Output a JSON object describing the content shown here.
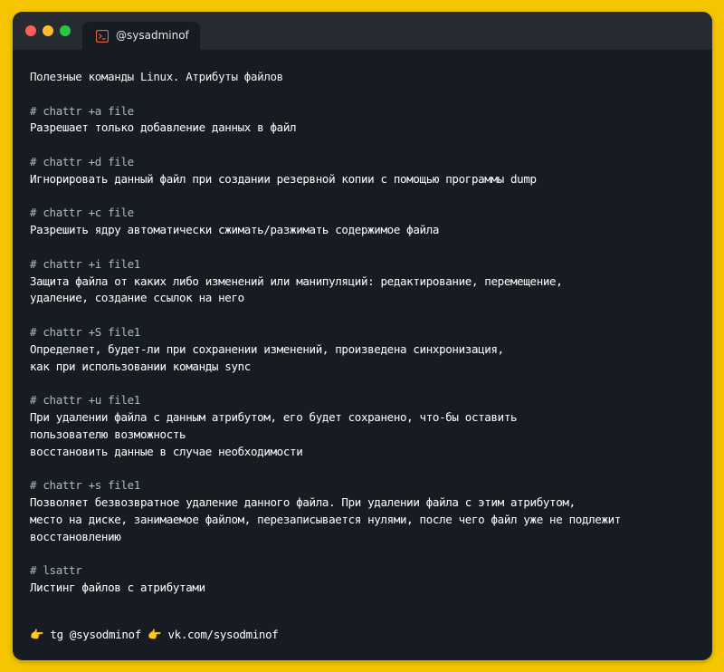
{
  "window": {
    "colors": {
      "background": "#171b22",
      "titlebar": "#262a31",
      "frame": "#f5c600"
    },
    "tab_label": "@sysadminof",
    "tab_icon": "terminal-icon"
  },
  "content": {
    "title": "Полезные команды Linux. Атрибуты файлов",
    "blocks": [
      {
        "cmd": "# chattr +a file",
        "desc": [
          "Разрешает только добавление данных в файл"
        ]
      },
      {
        "cmd": "# chattr +d file",
        "desc": [
          "Игнорировать данный файл при создании резервной копии с помощью программы dump"
        ]
      },
      {
        "cmd": "# chattr +c file",
        "desc": [
          "Разрешить ядру автоматически сжимать/разжимать содержимое файла"
        ]
      },
      {
        "cmd": "# chattr +i file1",
        "desc": [
          "Защита файла от каких либо изменений или манипуляций: редактирование, перемещение,",
          "удаление, создание ссылок на него"
        ]
      },
      {
        "cmd": "# chattr +S file1",
        "desc": [
          "Определяет, будет-ли при сохранении изменений, произведена синхронизация,",
          "как при использовании команды sync"
        ]
      },
      {
        "cmd": "# chattr +u file1",
        "desc": [
          "При удалении файла с данным атрибутом, его будет сохранено, что-бы оставить",
          "пользователю возможность",
          "восстановить данные в случае необходимости"
        ]
      },
      {
        "cmd": "# chattr +s file1",
        "desc": [
          "Позволяет безвозвратное удаление данного файла. При удалении файла с этим атрибутом,",
          "место на диске, занимаемое файлом, перезаписывается нулями, после чего файл уже не подлежит",
          "восстановлению"
        ]
      },
      {
        "cmd": "# lsattr",
        "desc": [
          "Листинг файлов с атрибутами"
        ]
      }
    ]
  },
  "footer": {
    "pointer_icon": "pointing-hand-icon",
    "tg_text": "tg @sysodminof",
    "vk_text": "vk.com/sysodminof"
  }
}
